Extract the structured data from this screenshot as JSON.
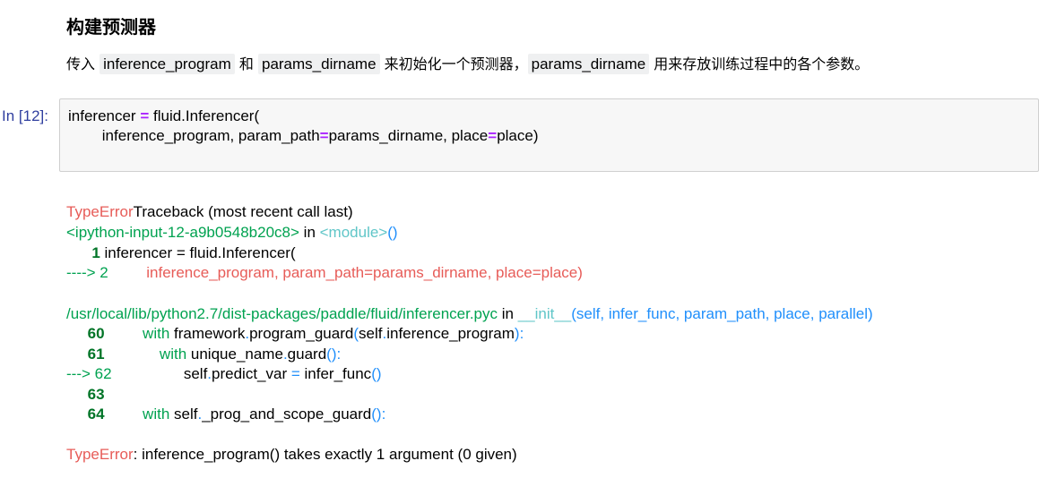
{
  "markdown": {
    "heading": "构建预测器",
    "para_1": "传入 ",
    "code_1": "inference_program",
    "para_2": " 和 ",
    "code_2": "params_dirname",
    "para_3": " 来初始化一个预测器，",
    "code_3": "params_dirname",
    "para_4": " 用来存放训练过程中的各个参数。"
  },
  "cell": {
    "prompt": "In [12]:",
    "line1_a": "inferencer ",
    "line1_op": "=",
    "line1_b": " fluid.Inferencer(",
    "line2_a": "        inference_program, param_path",
    "line2_op1": "=",
    "line2_b": "params_dirname, place",
    "line2_op2": "=",
    "line2_c": "place)"
  },
  "traceback": {
    "error_type": "TypeError",
    "header_rest": "Traceback (most recent call last)",
    "file1": "<ipython-input-12-a9b0548b20c8>",
    "in_1": " in ",
    "module": "<module>",
    "module_paren": "()",
    "t1_num": "      1",
    "t1_code": " inferencer = fluid.Inferencer(",
    "t2_arrow": "----> 2",
    "t2_code": "         inference_program, param_path=params_dirname, place=place)",
    "file2": "/usr/local/lib/python2.7/dist-packages/paddle/fluid/inferencer.pyc",
    "in_2": " in ",
    "func": "__init__",
    "func_args": "(self, infer_func, param_path, place, parallel)",
    "l60_num": "     60",
    "l60_kw": "         with",
    "l60_a": " framework",
    "l60_dot": ".",
    "l60_b": "program_guard",
    "l60_paren": "(",
    "l60_c": "self",
    "l60_dot2": ".",
    "l60_d": "inference_program",
    "l60_end": "):",
    "l61_num": "     61",
    "l61_kw": "             with",
    "l61_a": " unique_name",
    "l61_dot": ".",
    "l61_b": "guard",
    "l61_end": "():",
    "l62_arrow": "---> 62",
    "l62_a": "                 self",
    "l62_dot": ".",
    "l62_b": "predict_var ",
    "l62_eq": "=",
    "l62_c": " infer_func",
    "l62_end": "()",
    "l63_num": "     63",
    "l64_num": "     64",
    "l64_kw": "         with",
    "l64_a": " self",
    "l64_dot": ".",
    "l64_b": "_prog_and_scope_guard",
    "l64_end": "():",
    "final_type": "TypeError",
    "final_msg": ": inference_program() takes exactly 1 argument (0 given)"
  }
}
